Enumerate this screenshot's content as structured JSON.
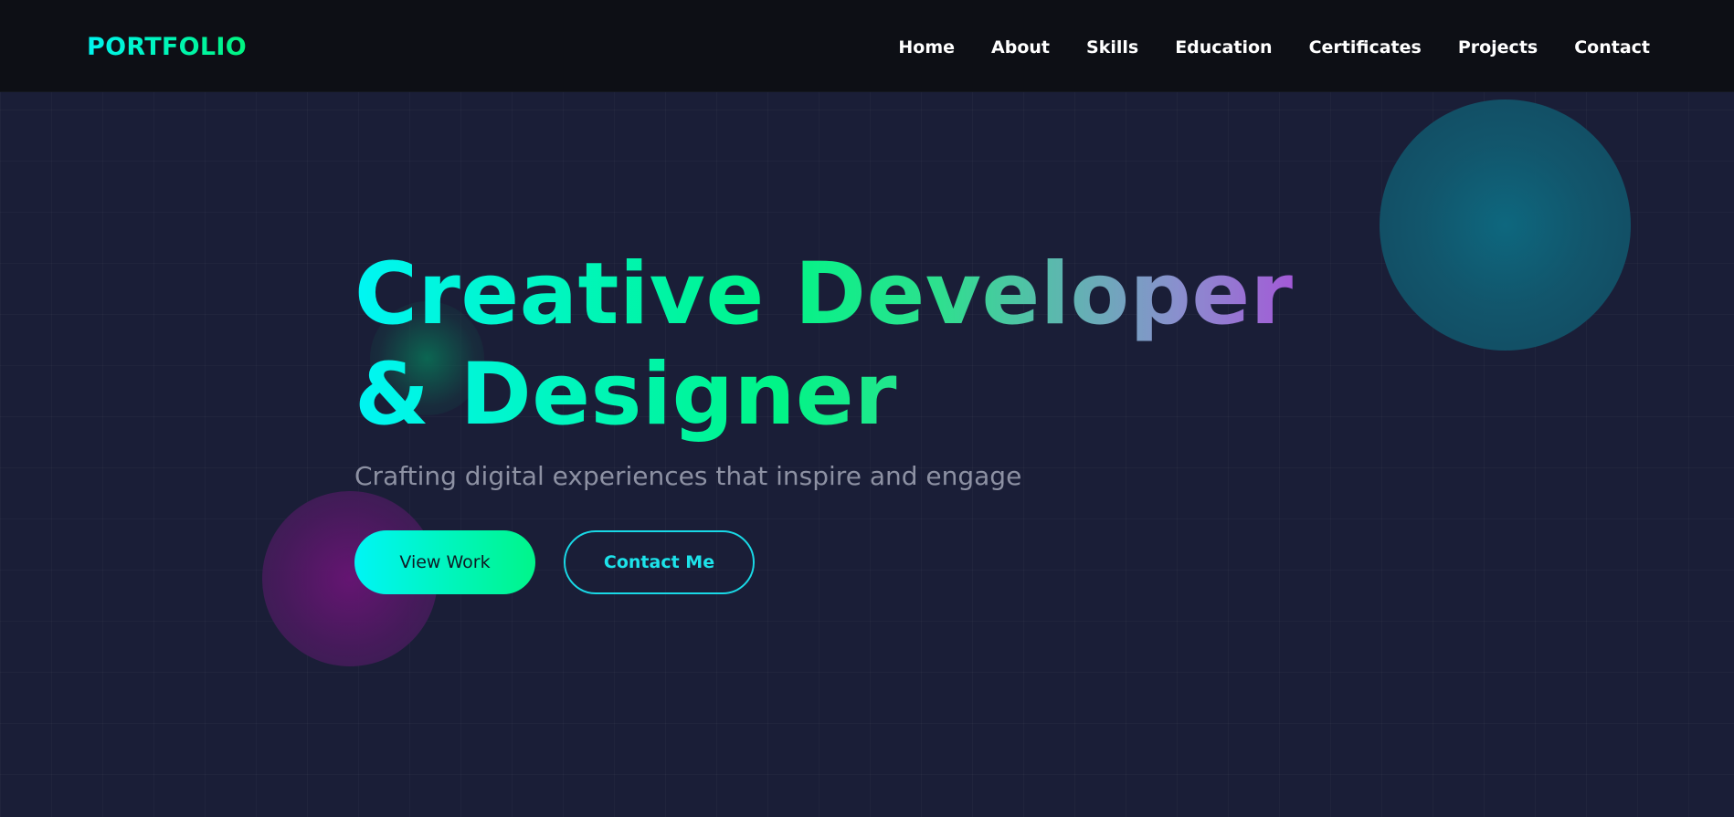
{
  "navbar": {
    "logo": "PORTFOLIO",
    "links": [
      "Home",
      "About",
      "Skills",
      "Education",
      "Certificates",
      "Projects",
      "Contact"
    ]
  },
  "hero": {
    "title": "Creative Developer & Designer",
    "subtitle": "Crafting digital experiences that inspire and engage",
    "primary_button": "View Work",
    "secondary_button": "Contact Me"
  },
  "colors": {
    "background": "#1a1e37",
    "navbar": "#0d0f15",
    "accent_cyan": "#00f5f5",
    "accent_green": "#00f58a",
    "accent_purple": "#b13bdc",
    "subtitle_gray": "#8d91a3"
  }
}
